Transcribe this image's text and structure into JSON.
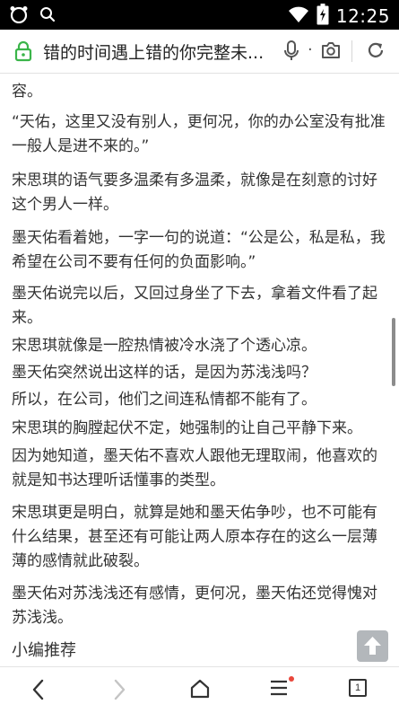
{
  "status_bar": {
    "time": "12:25"
  },
  "url_bar": {
    "page_title": "错的时间遇上错的你完整未..."
  },
  "article": {
    "paragraphs": [
      "容。",
      "“天佑，这里又没有别人，更何况，你的办公室没有批准一般人是进不来的。”",
      "宋思琪的语气要多温柔有多温柔，就像是在刻意的讨好这个男人一样。",
      "墨天佑看着她，一字一句的说道：“公是公，私是私，我希望在公司不要有任何的负面影响。”",
      "墨天佑说完以后，又回过身坐了下去，拿着文件看了起来。",
      "宋思琪就像是一腔热情被冷水浇了个透心凉。",
      "墨天佑突然说出这样的话，是因为苏浅浅吗？",
      "所以，在公司，他们之间连私情都不能有了。",
      "宋思琪的胸膛起伏不定，她强制的让自己平静下来。",
      "因为她知道，墨天佑不喜欢人跟他无理取闹，他喜欢的就是知书达理听话懂事的类型。",
      "宋思琪更是明白，就算是她和墨天佑争吵，也不可能有什么结果，甚至还有可能让两人原本存在的这么一层薄薄的感情就此破裂。",
      "墨天佑对苏浅浅还有感情，更何况，墨天佑还觉得愧对苏浅浅。"
    ],
    "recommend_heading": "小编推荐"
  },
  "bottom_bar": {
    "tab_count": "1"
  },
  "colors": {
    "status_bar_bg": "#000000",
    "lock_green": "#3bb54a",
    "notification_dot": "#e9473c",
    "back_to_top_bg": "#b3b7bb"
  }
}
